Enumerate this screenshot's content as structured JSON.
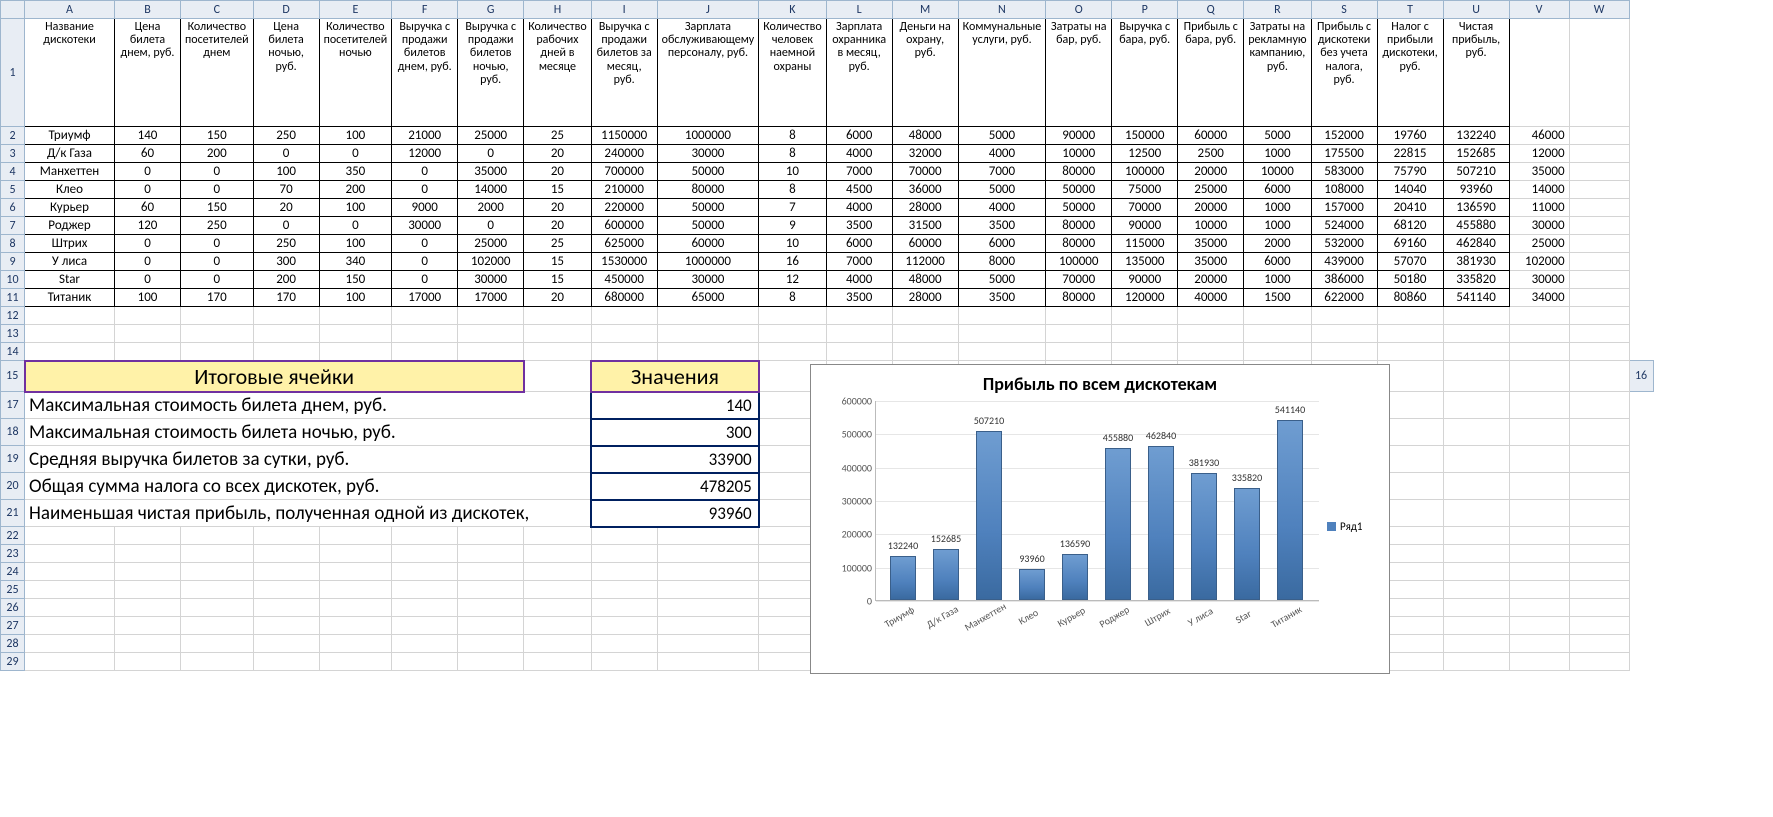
{
  "columns": [
    "",
    "A",
    "B",
    "C",
    "D",
    "E",
    "F",
    "G",
    "H",
    "I",
    "J",
    "K",
    "L",
    "M",
    "N",
    "O",
    "P",
    "Q",
    "R",
    "S",
    "T",
    "U",
    "V",
    "W"
  ],
  "headers": [
    "Название дискотеки",
    "Цена билета днем, руб.",
    "Количество посетителей днем",
    "Цена билета ночью, руб.",
    "Количество посетителей ночью",
    "Выручка с продажи билетов днем, руб.",
    "Выручка с продажи билетов ночью, руб.",
    "Количество рабочих дней в месяце",
    "Выручка с продажи билетов за месяц, руб.",
    "Зарплата обслуживающему персоналу, руб.",
    "Количество человек наемной охраны",
    "Зарплата охранника в месяц, руб.",
    "Деньги на охрану, руб.",
    "Коммунальные услуги, руб.",
    "Затраты на бар, руб.",
    "Выручка с бара, руб.",
    "Прибыль с бара, руб.",
    "Затраты на рекламную кампанию, руб.",
    "Прибыль с дискотеки без учета налога, руб.",
    "Налог с прибыли дискотеки, руб.",
    "Чистая прибыль, руб."
  ],
  "rows": [
    {
      "n": "Триумф",
      "d": [
        140,
        150,
        250,
        100,
        21000,
        25000,
        25,
        1150000,
        1000000,
        8,
        6000,
        48000,
        5000,
        90000,
        150000,
        60000,
        5000,
        152000,
        19760,
        132240
      ],
      "v": 46000
    },
    {
      "n": "Д/к Газа",
      "d": [
        60,
        200,
        0,
        0,
        12000,
        0,
        20,
        240000,
        30000,
        8,
        4000,
        32000,
        4000,
        10000,
        12500,
        2500,
        1000,
        175500,
        22815,
        152685
      ],
      "v": 12000
    },
    {
      "n": "Манхеттен",
      "d": [
        0,
        0,
        100,
        350,
        0,
        35000,
        20,
        700000,
        50000,
        10,
        7000,
        70000,
        7000,
        80000,
        100000,
        20000,
        10000,
        583000,
        75790,
        507210
      ],
      "v": 35000
    },
    {
      "n": "Клео",
      "d": [
        0,
        0,
        70,
        200,
        0,
        14000,
        15,
        210000,
        80000,
        8,
        4500,
        36000,
        5000,
        50000,
        75000,
        25000,
        6000,
        108000,
        14040,
        93960
      ],
      "v": 14000
    },
    {
      "n": "Курьер",
      "d": [
        60,
        150,
        20,
        100,
        9000,
        2000,
        20,
        220000,
        50000,
        7,
        4000,
        28000,
        4000,
        50000,
        70000,
        20000,
        1000,
        157000,
        20410,
        136590
      ],
      "v": 11000
    },
    {
      "n": "Роджер",
      "d": [
        120,
        250,
        0,
        0,
        30000,
        0,
        20,
        600000,
        50000,
        9,
        3500,
        31500,
        3500,
        80000,
        90000,
        10000,
        1000,
        524000,
        68120,
        455880
      ],
      "v": 30000
    },
    {
      "n": "Штрих",
      "d": [
        0,
        0,
        250,
        100,
        0,
        25000,
        25,
        625000,
        60000,
        10,
        6000,
        60000,
        6000,
        80000,
        115000,
        35000,
        2000,
        532000,
        69160,
        462840
      ],
      "v": 25000
    },
    {
      "n": "У лиса",
      "d": [
        0,
        0,
        300,
        340,
        0,
        102000,
        15,
        1530000,
        1000000,
        16,
        7000,
        112000,
        8000,
        100000,
        135000,
        35000,
        6000,
        439000,
        57070,
        381930
      ],
      "v": 102000
    },
    {
      "n": "Star",
      "d": [
        0,
        0,
        200,
        150,
        0,
        30000,
        15,
        450000,
        30000,
        12,
        4000,
        48000,
        5000,
        70000,
        90000,
        20000,
        1000,
        386000,
        50180,
        335820
      ],
      "v": 30000
    },
    {
      "n": "Титаник",
      "d": [
        100,
        170,
        170,
        100,
        17000,
        17000,
        20,
        680000,
        65000,
        8,
        3500,
        28000,
        3500,
        80000,
        120000,
        40000,
        1500,
        622000,
        80860,
        541140
      ],
      "v": 34000
    }
  ],
  "summary": {
    "title_left": "Итоговые ячейки",
    "title_right": "Значения",
    "items": [
      {
        "label": "Максимальная стоимость билета днем, руб.",
        "value": 140
      },
      {
        "label": "Максимальная стоимость билета ночью, руб.",
        "value": 300
      },
      {
        "label": "Средняя выручка билетов за сутки, руб.",
        "value": 33900
      },
      {
        "label": "Общая сумма налога со всех дискотек, руб.",
        "value": 478205
      },
      {
        "label": "Наименьшая чистая прибыль, полученная одной из дискотек,",
        "value": 93960
      }
    ]
  },
  "chart_data": {
    "type": "bar",
    "title": "Прибыль по всем дискотекам",
    "categories": [
      "Триумф",
      "Д/к Газа",
      "Манхеттен",
      "Клео",
      "Курьер",
      "Роджер",
      "Штрих",
      "У лиса",
      "Star",
      "Титаник"
    ],
    "values": [
      132240,
      152685,
      507210,
      93960,
      136590,
      455880,
      462840,
      381930,
      335820,
      541140
    ],
    "ylim": [
      0,
      600000
    ],
    "y_ticks": [
      0,
      100000,
      200000,
      300000,
      400000,
      500000,
      600000
    ],
    "legend": "Ряд1"
  },
  "col_widths": {
    "rowhdr": 24,
    "A": 90,
    "data": 66,
    "V": 60,
    "W": 60
  }
}
